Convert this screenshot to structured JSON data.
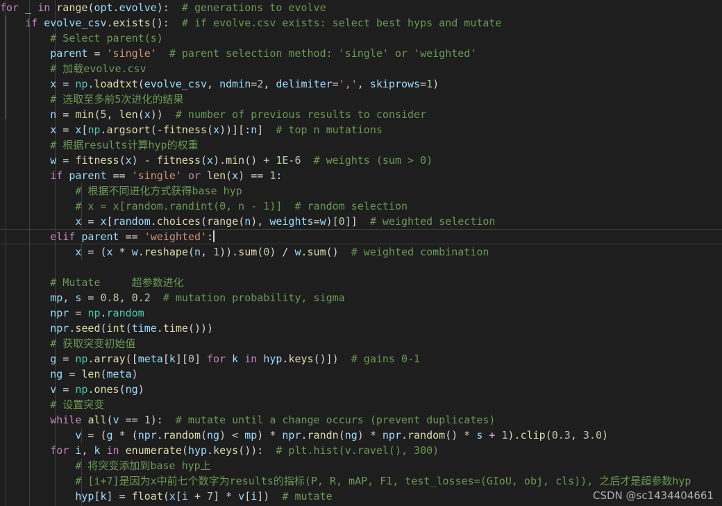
{
  "editor": {
    "theme": "dark-plus",
    "background": "#1e1e1e",
    "foreground": "#d4d4d4",
    "font_size_px": 15,
    "line_height_px": 22,
    "colors": {
      "keyword": "#c586c0",
      "variable": "#9cdcfe",
      "function": "#dcdcaa",
      "string": "#ce9178",
      "number": "#b5cea8",
      "comment": "#6a9955",
      "operator": "#d4d4d4",
      "module": "#4ec9b0",
      "indent_guide": "#404040",
      "indent_guide_active": "#707070",
      "current_line_border": "#3c3c3c",
      "cursor": "#d4d4d4"
    },
    "cursor": {
      "line_index": 15,
      "after_text": "elif parent == 'weighted':"
    }
  },
  "watermark": {
    "text": "CSDN @sc1434404661"
  },
  "code": {
    "language": "python",
    "lines": [
      "for _ in range(opt.evolve):  # generations to evolve",
      "    if evolve_csv.exists():  # if evolve.csv exists: select best hyps and mutate",
      "        # Select parent(s)",
      "        parent = 'single'  # parent selection method: 'single' or 'weighted'",
      "        # 加载evolve.csv",
      "        x = np.loadtxt(evolve_csv, ndmin=2, delimiter=',', skiprows=1)",
      "        # 选取至多前5次进化的结果",
      "        n = min(5, len(x))  # number of previous results to consider",
      "        x = x[np.argsort(-fitness(x))][:n]  # top n mutations",
      "        # 根据results计算hyp的权重",
      "        w = fitness(x) - fitness(x).min() + 1E-6  # weights (sum > 0)",
      "        if parent == 'single' or len(x) == 1:",
      "            # 根据不同进化方式获得base hyp",
      "            # x = x[random.randint(0, n - 1)]  # random selection",
      "            x = x[random.choices(range(n), weights=w)[0]]  # weighted selection",
      "        elif parent == 'weighted':",
      "            x = (x * w.reshape(n, 1)).sum(0) / w.sum()  # weighted combination",
      "",
      "        # Mutate     超参数进化",
      "        mp, s = 0.8, 0.2  # mutation probability, sigma",
      "        npr = np.random",
      "        npr.seed(int(time.time()))",
      "        # 获取突变初始值",
      "        g = np.array([meta[k][0] for k in hyp.keys()])  # gains 0-1",
      "        ng = len(meta)",
      "        v = np.ones(ng)",
      "        # 设置突变",
      "        while all(v == 1):  # mutate until a change occurs (prevent duplicates)",
      "            v = (g * (npr.random(ng) < mp) * npr.randn(ng) * npr.random() * s + 1).clip(0.3, 3.0)",
      "        for i, k in enumerate(hyp.keys()):  # plt.hist(v.ravel(), 300)",
      "            # 将突变添加到base hyp上",
      "            # [i+7]是因为x中前七个数字为results的指标(P, R, mAP, F1, test_losses=(GIoU, obj, cls)), 之后才是超参数hyp",
      "            hyp[k] = float(x[i + 7] * v[i])  # mutate"
    ]
  }
}
